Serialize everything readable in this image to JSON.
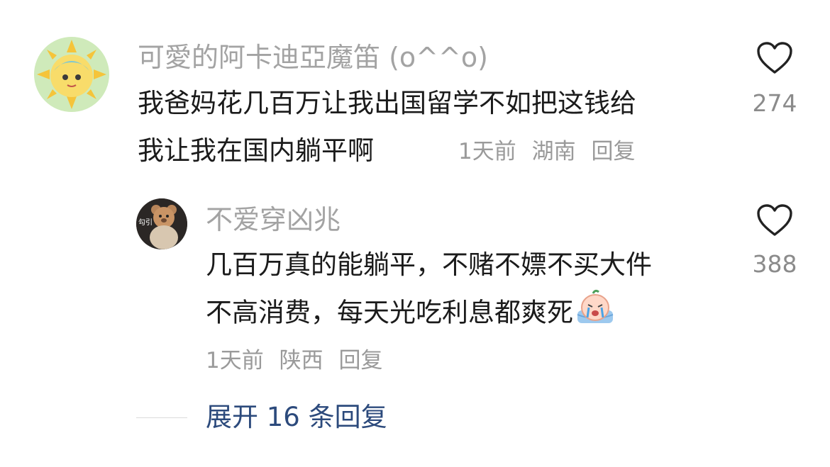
{
  "comments": [
    {
      "username": "可愛的阿卡迪亞魔笛 (o^^o)",
      "text_line1": "我爸妈花几百万让我出国留学不如把这钱给",
      "text_line2": "我让我在国内躺平啊",
      "time": "1天前",
      "location": "湖南",
      "reply": "回复",
      "likes": "274",
      "avatar_icon": "sun-avatar-icon"
    }
  ],
  "replies": [
    {
      "username": "不爱穿凶兆",
      "text_line1": "几百万真的能躺平，不赌不嫖不买大件",
      "text_line2": "不高消费，每天光吃利息都爽死",
      "time": "1天前",
      "location": "陕西",
      "reply": "回复",
      "likes": "388",
      "avatar_badge": "勾引",
      "avatar_icon": "teddy-bear-avatar-icon",
      "emoji_icon": "crying-face-emoji-icon"
    }
  ],
  "expand": {
    "label": "展开 16 条回复"
  }
}
